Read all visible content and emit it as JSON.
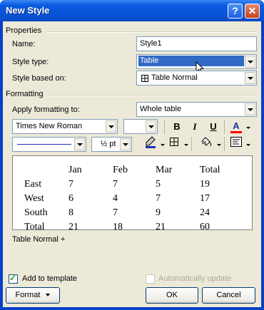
{
  "window": {
    "title": "New Style",
    "help_label": "?",
    "close_label": "✕"
  },
  "properties": {
    "heading": "Properties",
    "name_label": "Name:",
    "name_value": "Style1",
    "style_type_label": "Style type:",
    "style_type_value": "Table",
    "based_on_label": "Style based on:",
    "based_on_value": "Table Normal"
  },
  "formatting": {
    "heading": "Formatting",
    "apply_label": "Apply formatting to:",
    "apply_value": "Whole table",
    "font_value": "Times New Roman",
    "size_value": "",
    "bold_label": "B",
    "italic_label": "I",
    "font_color_label": "A",
    "line_weight_value": "½ pt",
    "font_color_accent": "#ff0000",
    "border_color_accent": "#1f2fb7"
  },
  "preview": {
    "headers": [
      "",
      "Jan",
      "Feb",
      "Mar",
      "Total"
    ],
    "rows": [
      [
        "East",
        "7",
        "7",
        "5",
        "19"
      ],
      [
        "West",
        "6",
        "4",
        "7",
        "17"
      ],
      [
        "South",
        "8",
        "7",
        "9",
        "24"
      ],
      [
        "Total",
        "21",
        "18",
        "21",
        "60"
      ]
    ]
  },
  "description": "Table Normal +",
  "options": {
    "add_to_template_label": "Add to template",
    "add_to_template_checked": true,
    "auto_update_label": "Automatically update",
    "auto_update_checked": false
  },
  "buttons": {
    "format_label": "Format",
    "ok_label": "OK",
    "cancel_label": "Cancel"
  }
}
